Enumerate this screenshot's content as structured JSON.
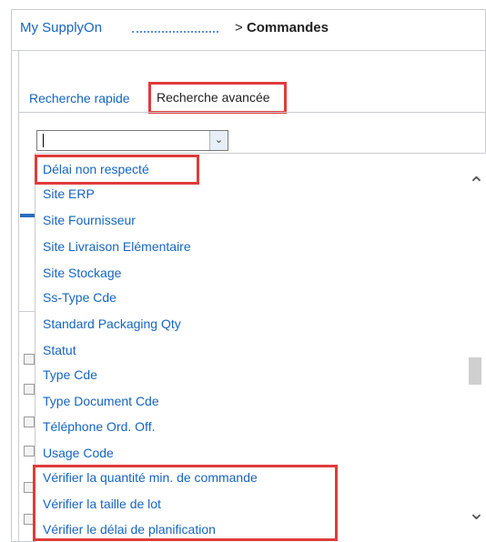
{
  "breadcrumb": {
    "home": "My SupplyOn",
    "separator": ">",
    "current": "Commandes"
  },
  "tabs": {
    "quick_search": "Recherche rapide",
    "advanced_search": "Recherche avancée"
  },
  "combo": {
    "value": ""
  },
  "dropdown": {
    "items": [
      "Délai non respecté",
      "Site ERP",
      "Site Fournisseur",
      "Site Livraison Elémentaire",
      "Site Stockage",
      "Ss-Type Cde",
      "Standard Packaging Qty",
      "Statut",
      "Type Cde",
      "Type Document Cde",
      "Téléphone Ord. Off.",
      "Usage Code",
      "Vérifier la quantité min. de commande",
      "Vérifier la taille de lot",
      "Vérifier le délai de planification"
    ]
  },
  "colors": {
    "link": "#1565c0",
    "highlight": "#e03b3b",
    "border": "#c9ccd0"
  },
  "icons": {
    "combo_arrow": "chevron-down-icon",
    "scroll_up": "chevron-up-icon",
    "scroll_down": "chevron-down-icon"
  }
}
